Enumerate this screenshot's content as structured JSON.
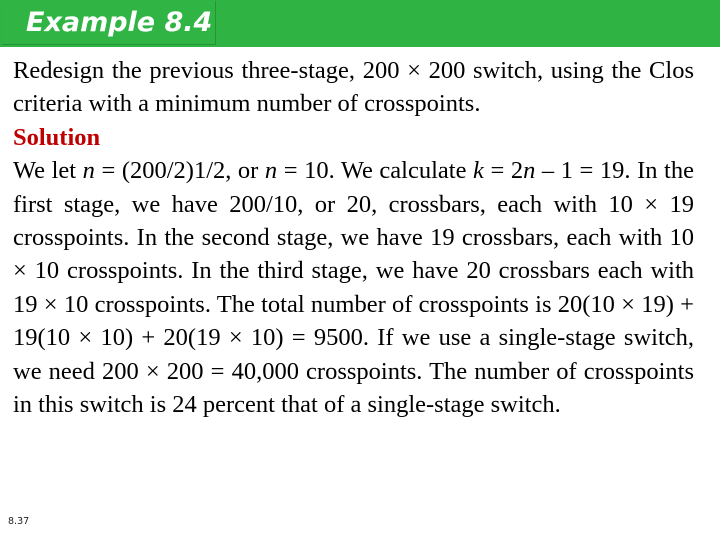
{
  "slide": {
    "header": {
      "title": "Example 8.4",
      "banner_color": "#2FB443",
      "inner_box_color": "#30B544",
      "title_color": "#FFFFFF"
    },
    "body": {
      "intro_line1": "Redesign the previous three-stage, 200 × 200 switch, using",
      "intro_line2": "the Clos criteria with a minimum number of crosspoints.",
      "solution_heading": "Solution",
      "solution_color": "#C00000",
      "solution_text": {
        "s1": "We let ",
        "v1": "n",
        "s2": " = (200/2)1/2, or ",
        "v2": "n",
        "s3": " = 10. We calculate ",
        "v3": "k",
        "s4": " = 2",
        "v4": "n",
        "s5": " – 1 = 19. In the first stage, we have 200/10, or 20, crossbars, each with 10 × 19 crosspoints. In the second stage, we have 19 crossbars, each with 10 × 10 crosspoints. In the third stage, we have 20 crossbars each with 19 × 10 crosspoints. The total number of crosspoints is 20(10 × 19) + 19(10 × 10) + 20(19 × 10) = 9500. If we use a single-stage switch, we need 200 × 200 = 40,000 crosspoints. The number of crosspoints in this switch is 24 percent that of a single-stage switch."
      }
    },
    "footer": {
      "page_number": "8.37"
    }
  }
}
